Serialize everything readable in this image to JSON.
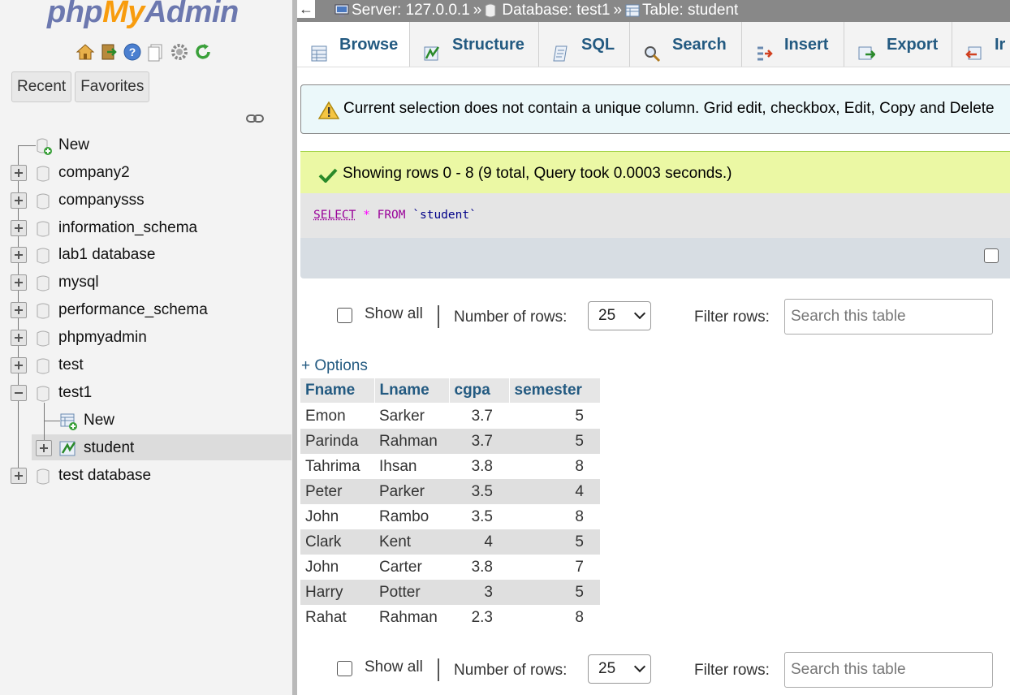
{
  "logo": {
    "php": "php",
    "my": "My",
    "admin": "Admin"
  },
  "nav": {
    "tabs": [
      "Recent",
      "Favorites"
    ],
    "tree": [
      {
        "label": "New",
        "kind": "new"
      },
      {
        "label": "company2",
        "kind": "db"
      },
      {
        "label": "companysss",
        "kind": "db"
      },
      {
        "label": "information_schema",
        "kind": "db"
      },
      {
        "label": "lab1 database",
        "kind": "db"
      },
      {
        "label": "mysql",
        "kind": "db"
      },
      {
        "label": "performance_schema",
        "kind": "db"
      },
      {
        "label": "phpmyadmin",
        "kind": "db"
      },
      {
        "label": "test",
        "kind": "db"
      },
      {
        "label": "test1",
        "kind": "db-open"
      },
      {
        "label": "New",
        "kind": "child-new"
      },
      {
        "label": "student",
        "kind": "child-table"
      },
      {
        "label": "test database",
        "kind": "db"
      }
    ]
  },
  "breadcrumb": {
    "back": "←",
    "server": "Server: 127.0.0.1",
    "sep": "»",
    "database": "Database: test1",
    "table": "Table: student"
  },
  "tabs": [
    "Browse",
    "Structure",
    "SQL",
    "Search",
    "Insert",
    "Export",
    "Ir"
  ],
  "notice": "Current selection does not contain a unique column. Grid edit, checkbox, Edit, Copy and Delete",
  "success": "Showing rows 0 - 8 (9 total, Query took 0.0003 seconds.)",
  "sql": {
    "select": "SELECT",
    "star": "*",
    "from": "FROM",
    "table": "`student`"
  },
  "controls": {
    "show_all": "Show all",
    "number_of_rows": "Number of rows:",
    "rows_value": "25",
    "filter_rows": "Filter rows:",
    "filter_placeholder": "Search this table"
  },
  "options_link": "+ Options",
  "table": {
    "columns": [
      "Fname",
      "Lname",
      "cgpa",
      "semester"
    ],
    "rows": [
      [
        "Emon",
        "Sarker",
        "3.7",
        "5"
      ],
      [
        "Parinda",
        "Rahman",
        "3.7",
        "5"
      ],
      [
        "Tahrima",
        "Ihsan",
        "3.8",
        "8"
      ],
      [
        "Peter",
        "Parker",
        "3.5",
        "4"
      ],
      [
        "John",
        "Rambo",
        "3.5",
        "8"
      ],
      [
        "Clark",
        "Kent",
        "4",
        "5"
      ],
      [
        "John",
        "Carter",
        "3.8",
        "7"
      ],
      [
        "Harry",
        "Potter",
        "3",
        "5"
      ],
      [
        "Rahat",
        "Rahman",
        "2.3",
        "8"
      ]
    ]
  }
}
